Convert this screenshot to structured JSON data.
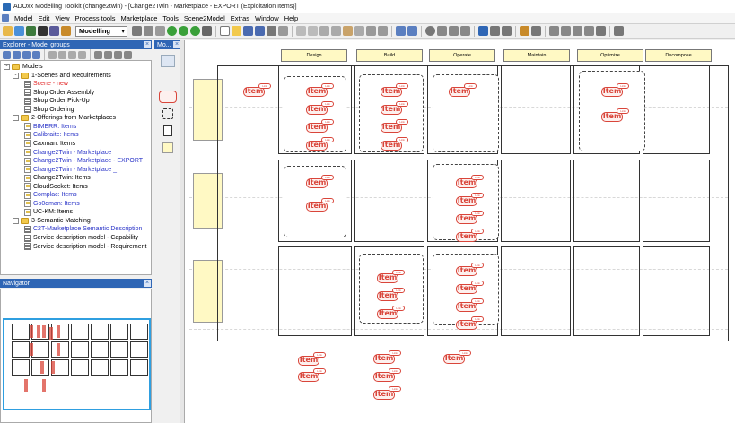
{
  "window": {
    "title": "ADOxx Modelling Toolkit (change2twin) - [Change2Twin - Marketplace - EXPORT (Exploitation Items)]"
  },
  "menu": [
    "Model",
    "Edit",
    "View",
    "Process tools",
    "Marketplace",
    "Tools",
    "Scene2Model",
    "Extras",
    "Window",
    "Help"
  ],
  "toolbar": {
    "mode": "Modelling"
  },
  "explorer": {
    "title": "Explorer - Model groups",
    "items": [
      {
        "label": "Models",
        "indent": 0,
        "kind": "folder",
        "color": "default",
        "expander": "-"
      },
      {
        "label": "1-Scenes and Requirements",
        "indent": 1,
        "kind": "folder",
        "color": "default",
        "expander": "-"
      },
      {
        "label": "Scene - new",
        "indent": 2,
        "kind": "model",
        "color": "red"
      },
      {
        "label": "Shop Order Assembly",
        "indent": 2,
        "kind": "model",
        "color": "default"
      },
      {
        "label": "Shop Order Pick-Up",
        "indent": 2,
        "kind": "model",
        "color": "default"
      },
      {
        "label": "Shop Ordering",
        "indent": 2,
        "kind": "model",
        "color": "default"
      },
      {
        "label": "2-Offerings from Marketplaces",
        "indent": 1,
        "kind": "folder",
        "color": "default",
        "expander": "-"
      },
      {
        "label": "BIMERR: Items",
        "indent": 2,
        "kind": "model",
        "color": "blue"
      },
      {
        "label": "Calibraite: Items",
        "indent": 2,
        "kind": "model",
        "color": "blue"
      },
      {
        "label": "Caxman: Items",
        "indent": 2,
        "kind": "model",
        "color": "default"
      },
      {
        "label": "Change2Twin - Marketplace",
        "indent": 2,
        "kind": "model",
        "color": "blue"
      },
      {
        "label": "Change2Twin - Marketplace - EXPORT",
        "indent": 2,
        "kind": "model",
        "color": "blue"
      },
      {
        "label": "Change2Twin - Marketplace _",
        "indent": 2,
        "kind": "model",
        "color": "blue"
      },
      {
        "label": "Change2Twin: Items",
        "indent": 2,
        "kind": "model",
        "color": "default"
      },
      {
        "label": "CloudSocket: Items",
        "indent": 2,
        "kind": "model",
        "color": "default"
      },
      {
        "label": "Complac: Items",
        "indent": 2,
        "kind": "model",
        "color": "blue"
      },
      {
        "label": "Go0dman: Items",
        "indent": 2,
        "kind": "model",
        "color": "blue"
      },
      {
        "label": "UC-KM: Items",
        "indent": 2,
        "kind": "model",
        "color": "default"
      },
      {
        "label": "3-Semantic Matching",
        "indent": 1,
        "kind": "folder",
        "color": "default",
        "expander": "-"
      },
      {
        "label": "C2T-Marketplace Semantic Description",
        "indent": 2,
        "kind": "model",
        "color": "blue"
      },
      {
        "label": "Service description model - Capability",
        "indent": 2,
        "kind": "model",
        "color": "default"
      },
      {
        "label": "Service description model - Requirement",
        "indent": 2,
        "kind": "model",
        "color": "default"
      }
    ]
  },
  "palette": {
    "title": "Mo..."
  },
  "navigator": {
    "title": "Navigator"
  },
  "canvas": {
    "columns": [
      "Design",
      "Build",
      "Operate",
      "Maintain",
      "Optimize",
      "Decompose"
    ],
    "item_word": "Item",
    "item_tag": "Link"
  },
  "colors": {
    "accent": "#2f66b5",
    "item_red": "#d9453a",
    "header_yellow": "#fff9c4",
    "tree_red": "#e32b2b",
    "tree_blue": "#2a34c8"
  }
}
